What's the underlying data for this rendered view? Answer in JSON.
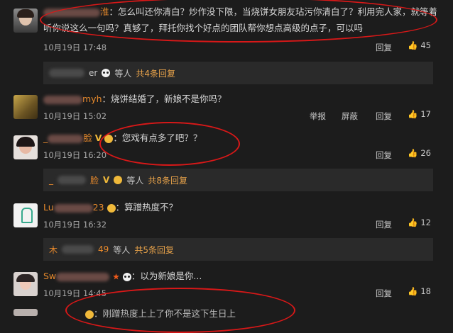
{
  "comments": [
    {
      "text": "：怎么叫还你清白？炒作没下限，当烧饼女朋友玷污你清白了？利用完人家，就等着",
      "text2": "听你说这么一句吗？真够了，拜托你找个好点的团队帮你想点高级的点子，可以吗",
      "time": "10月19日 17:48",
      "reply": "回复",
      "likes": "45",
      "name_visible": "淮"
    },
    {
      "name_visible": "myh",
      "text": "：烧饼结婚了，新娘不是你吗？",
      "time": "10月19日 15:02",
      "report": "举报",
      "block": "屏蔽",
      "reply": "回复",
      "likes": "17"
    },
    {
      "name_visible": "_",
      "name_suffix": "脸",
      "text": "：您戏有点多了吧？？",
      "time": "10月19日 16:20",
      "reply": "回复",
      "likes": "26"
    },
    {
      "name_visible": "Lu",
      "name_suffix": "23",
      "text": "：算蹭热度不？",
      "time": "10月19日 16:32",
      "reply": "回复",
      "likes": "12"
    },
    {
      "name_visible": "Sw",
      "text": "：以为新娘是你...",
      "time": "10月19日 14:45",
      "reply": "回复",
      "likes": "18"
    }
  ],
  "reply_boxes": [
    {
      "name_suffix": "er",
      "others": "等人",
      "count": "共4条回复"
    },
    {
      "name_visible": "_",
      "name_suffix": "脸",
      "others": "等人",
      "count": "共8条回复"
    },
    {
      "name_visible": "木",
      "name_suffix": "49",
      "others": "等人",
      "count": "共5条回复"
    }
  ],
  "partial_bottom": {
    "text": "：刚蹭热度上上了你不是这下生日上"
  }
}
